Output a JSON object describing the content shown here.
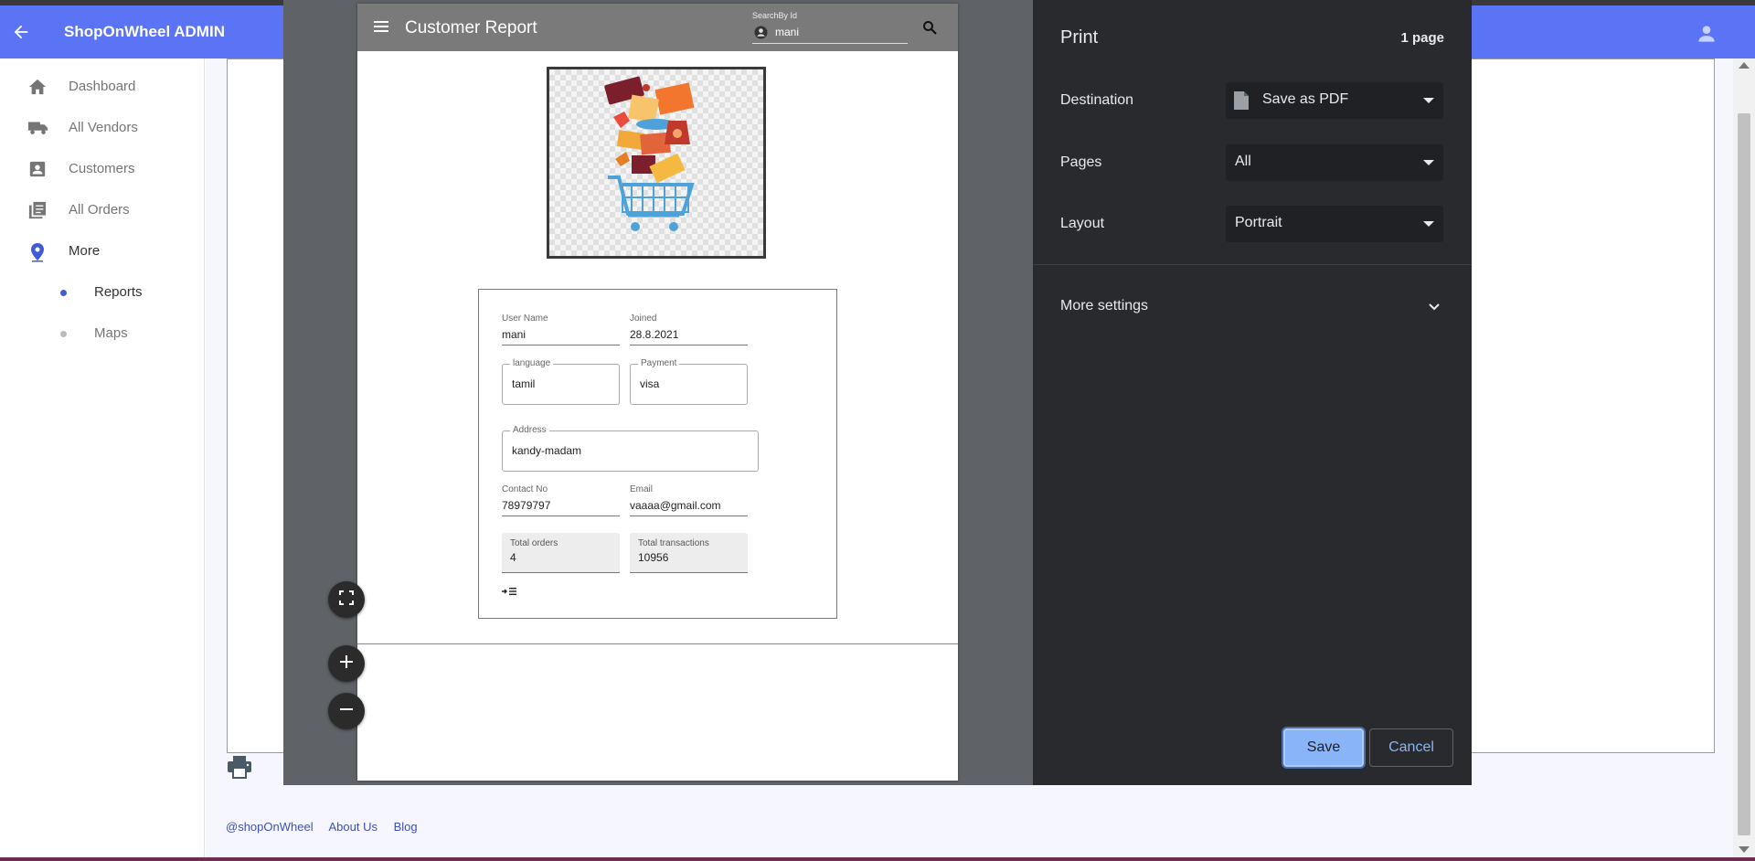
{
  "app": {
    "title": "ShopOnWheel ADMIN",
    "brand_color": "#5b73f5",
    "sidebar": {
      "items": [
        {
          "label": "Dashboard",
          "icon": "home-icon"
        },
        {
          "label": "All Vendors",
          "icon": "truck-icon"
        },
        {
          "label": "Customers",
          "icon": "contact-card-icon"
        },
        {
          "label": "All Orders",
          "icon": "library-books-icon"
        },
        {
          "label": "More",
          "icon": "location-pin-icon"
        }
      ],
      "subitems": [
        {
          "label": "Reports",
          "active": true
        },
        {
          "label": "Maps",
          "active": false
        }
      ]
    },
    "footer": {
      "links": [
        "@shopOnWheel",
        "About Us",
        "Blog"
      ]
    }
  },
  "preview": {
    "header_title": "Customer Report",
    "search": {
      "label": "SearchBy Id",
      "value": "mani"
    },
    "form": {
      "user_name": {
        "label": "User Name",
        "value": "mani"
      },
      "joined": {
        "label": "Joined",
        "value": "28.8.2021"
      },
      "language": {
        "label": "language",
        "value": "tamil"
      },
      "payment": {
        "label": "Payment",
        "value": "visa"
      },
      "address": {
        "label": "Address",
        "value": "kandy-madam"
      },
      "contact": {
        "label": "Contact No",
        "value": "78979797"
      },
      "email": {
        "label": "Email",
        "value": "vaaaa@gmail.com"
      },
      "total_orders": {
        "label": "Total orders",
        "value": "4"
      },
      "total_transactions": {
        "label": "Total transactions",
        "value": "10956"
      }
    }
  },
  "print_panel": {
    "title": "Print",
    "page_count": "1 page",
    "destination": {
      "label": "Destination",
      "value": "Save as PDF"
    },
    "pages": {
      "label": "Pages",
      "value": "All"
    },
    "layout": {
      "label": "Layout",
      "value": "Portrait"
    },
    "more_settings": "More settings",
    "save_label": "Save",
    "cancel_label": "Cancel",
    "accent": "#8ab4f8"
  }
}
